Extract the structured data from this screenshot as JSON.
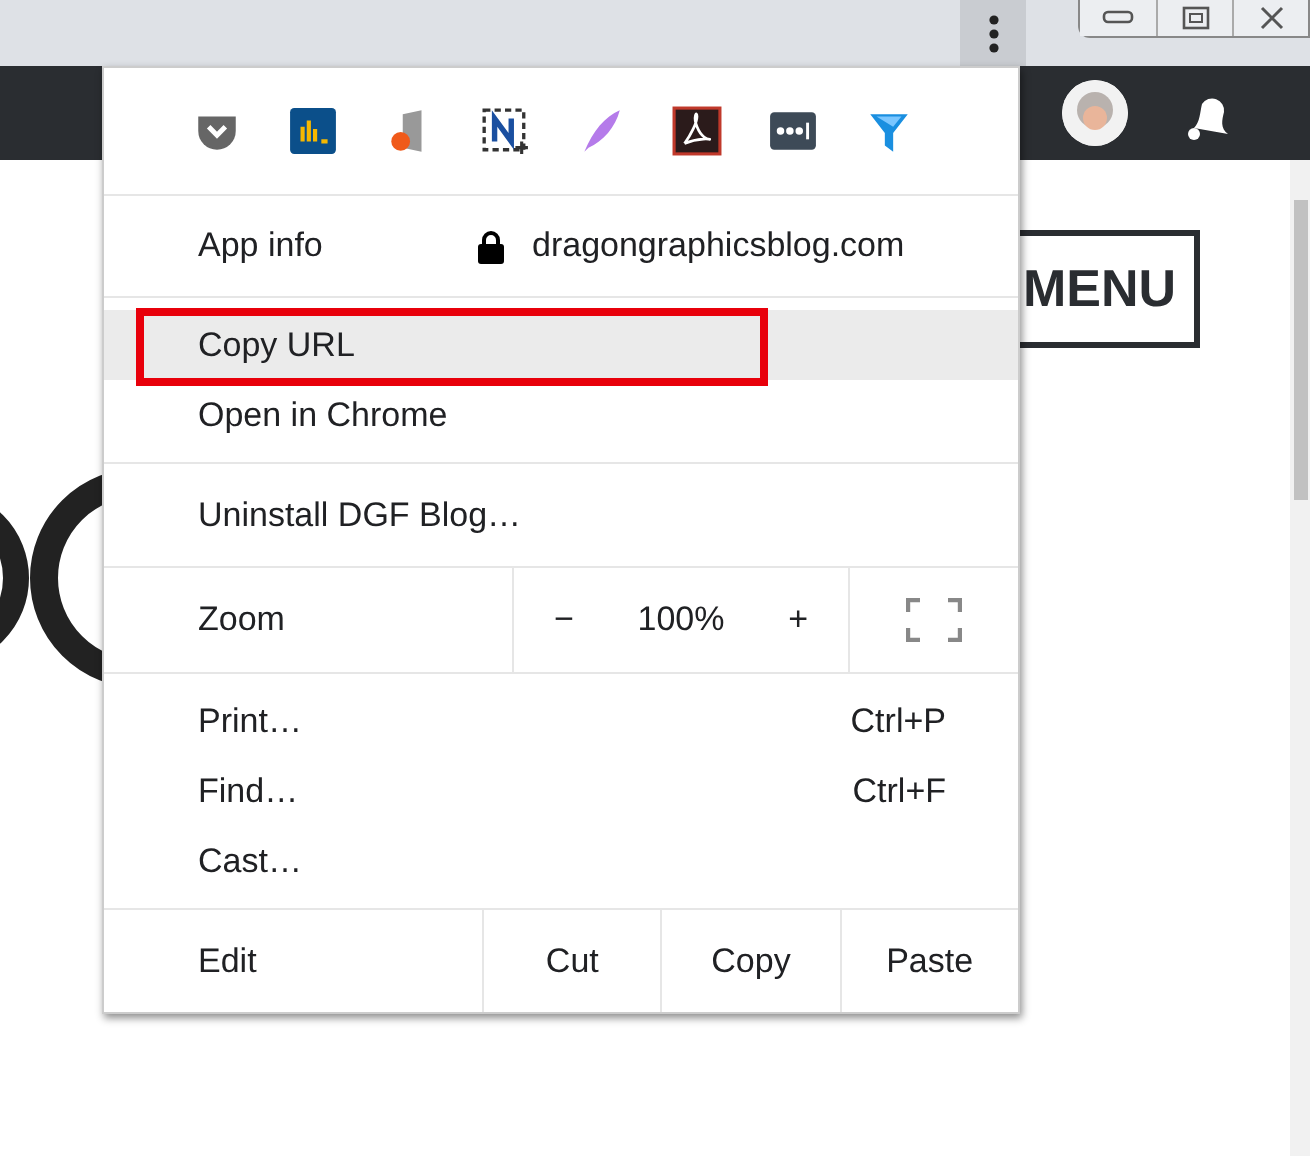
{
  "page": {
    "menu_button": "MENU"
  },
  "app_menu": {
    "app_info": {
      "label": "App info",
      "domain": "dragongraphicsblog.com"
    },
    "groups": [
      [
        {
          "label": "Copy URL",
          "highlighted": true,
          "outlined": true
        },
        {
          "label": "Open in Chrome",
          "highlighted": false,
          "outlined": false
        }
      ],
      [
        {
          "label": "Uninstall DGF Blog…",
          "highlighted": false,
          "outlined": false
        }
      ]
    ],
    "zoom": {
      "label": "Zoom",
      "minus": "−",
      "value": "100%",
      "plus": "+"
    },
    "commands": [
      {
        "label": "Print…",
        "shortcut": "Ctrl+P"
      },
      {
        "label": "Find…",
        "shortcut": "Ctrl+F"
      },
      {
        "label": "Cast…"
      }
    ],
    "edit": {
      "label": "Edit",
      "actions": [
        "Cut",
        "Copy",
        "Paste"
      ]
    }
  }
}
